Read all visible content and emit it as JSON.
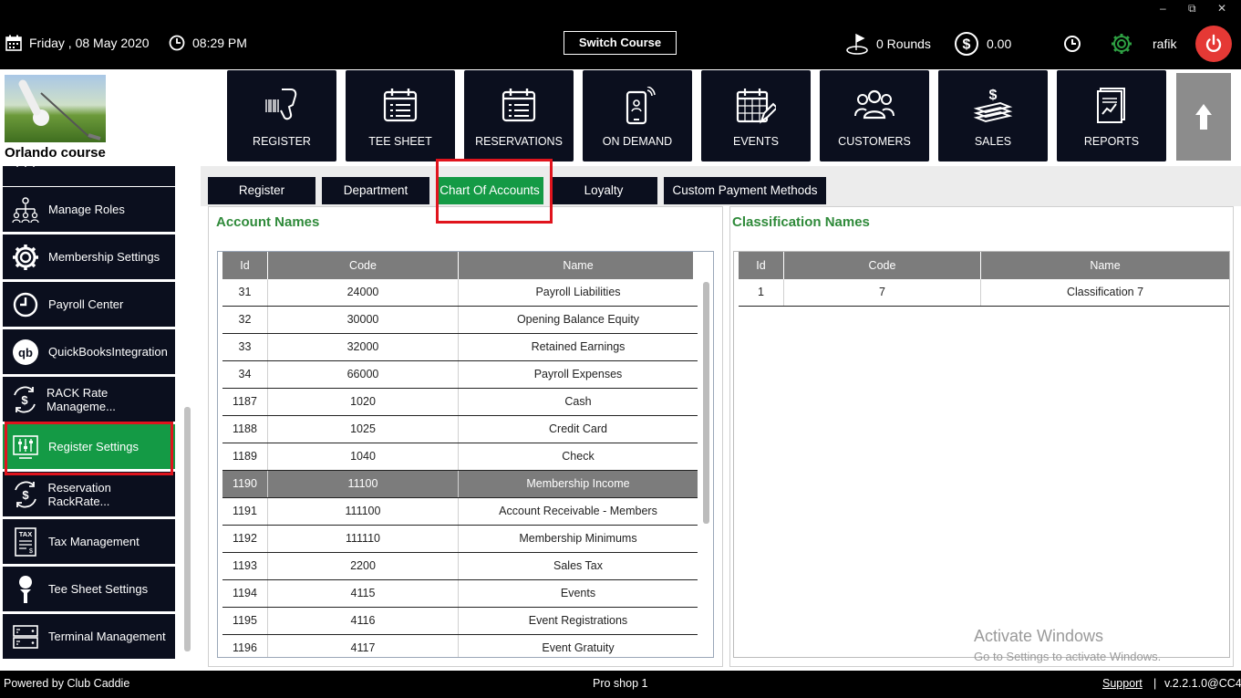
{
  "topbar": {
    "date": "Friday ,  08 May 2020",
    "time": "08:29 PM",
    "switch_label": "Switch Course",
    "rounds": "0 Rounds",
    "amount": "0.00",
    "user": "rafik",
    "win_min": "–",
    "win_restore": "⧉",
    "win_close": "✕"
  },
  "course_name": "Orlando course",
  "nav": [
    {
      "label": "REGISTER",
      "icon": "barcode-scanner-icon"
    },
    {
      "label": "TEE SHEET",
      "icon": "calendar-list-icon"
    },
    {
      "label": "RESERVATIONS",
      "icon": "calendar-list-icon"
    },
    {
      "label": "ON DEMAND",
      "icon": "phone-icon"
    },
    {
      "label": "EVENTS",
      "icon": "calendar-edit-icon"
    },
    {
      "label": "CUSTOMERS",
      "icon": "people-icon"
    },
    {
      "label": "SALES",
      "icon": "cash-stack-icon"
    },
    {
      "label": "REPORTS",
      "icon": "report-icon"
    }
  ],
  "sidebar": {
    "items": [
      {
        "label": "Manage Roles",
        "icon": "org-chart-icon"
      },
      {
        "label": "Membership Settings",
        "icon": "gear-icon"
      },
      {
        "label": "Payroll Center",
        "icon": "clock-icon"
      },
      {
        "label": "QuickBooksIntegration",
        "icon": "quickbooks-icon"
      },
      {
        "label": "RACK Rate Manageme...",
        "icon": "money-cycle-icon"
      },
      {
        "label": "Register Settings",
        "icon": "sliders-icon"
      },
      {
        "label": "Reservation RackRate...",
        "icon": "money-cycle-icon"
      },
      {
        "label": "Tax Management",
        "icon": "tax-doc-icon"
      },
      {
        "label": "Tee Sheet Settings",
        "icon": "golf-tee-icon"
      },
      {
        "label": "Terminal Management",
        "icon": "terminal-icon"
      }
    ]
  },
  "tabs": [
    "Register",
    "Department",
    "Chart Of Accounts",
    "Loyalty",
    "Custom Payment Methods"
  ],
  "accounts": {
    "title": "Account Names",
    "headers": [
      "Id",
      "Code",
      "Name"
    ],
    "rows": [
      [
        "31",
        "24000",
        "Payroll Liabilities"
      ],
      [
        "32",
        "30000",
        "Opening Balance Equity"
      ],
      [
        "33",
        "32000",
        "Retained Earnings"
      ],
      [
        "34",
        "66000",
        "Payroll Expenses"
      ],
      [
        "1187",
        "1020",
        "Cash"
      ],
      [
        "1188",
        "1025",
        "Credit Card"
      ],
      [
        "1189",
        "1040",
        "Check"
      ],
      [
        "1190",
        "11100",
        "Membership Income"
      ],
      [
        "1191",
        "111100",
        "Account Receivable - Members"
      ],
      [
        "1192",
        "111110",
        "Membership Minimums"
      ],
      [
        "1193",
        "2200",
        "Sales Tax"
      ],
      [
        "1194",
        "4115",
        "Events"
      ],
      [
        "1195",
        "4116",
        "Event Registrations"
      ],
      [
        "1196",
        "4117",
        "Event Gratuity"
      ]
    ]
  },
  "classifications": {
    "title": "Classification Names",
    "headers": [
      "Id",
      "Code",
      "Name"
    ],
    "rows": [
      [
        "1",
        "7",
        "Classification 7"
      ]
    ]
  },
  "watermark": {
    "line1": "Activate Windows",
    "line2": "Go to Settings to activate Windows."
  },
  "footer": {
    "powered": "Powered by Club Caddie",
    "shop": "Pro shop 1",
    "support": "Support",
    "sep": "|",
    "version": "v.2.2.1.0@CC4"
  },
  "colors": {
    "accent_green": "#149a45",
    "dark_navy": "#0b0f1e",
    "highlight_red": "#e0141d",
    "title_green": "#2f8a3a"
  }
}
